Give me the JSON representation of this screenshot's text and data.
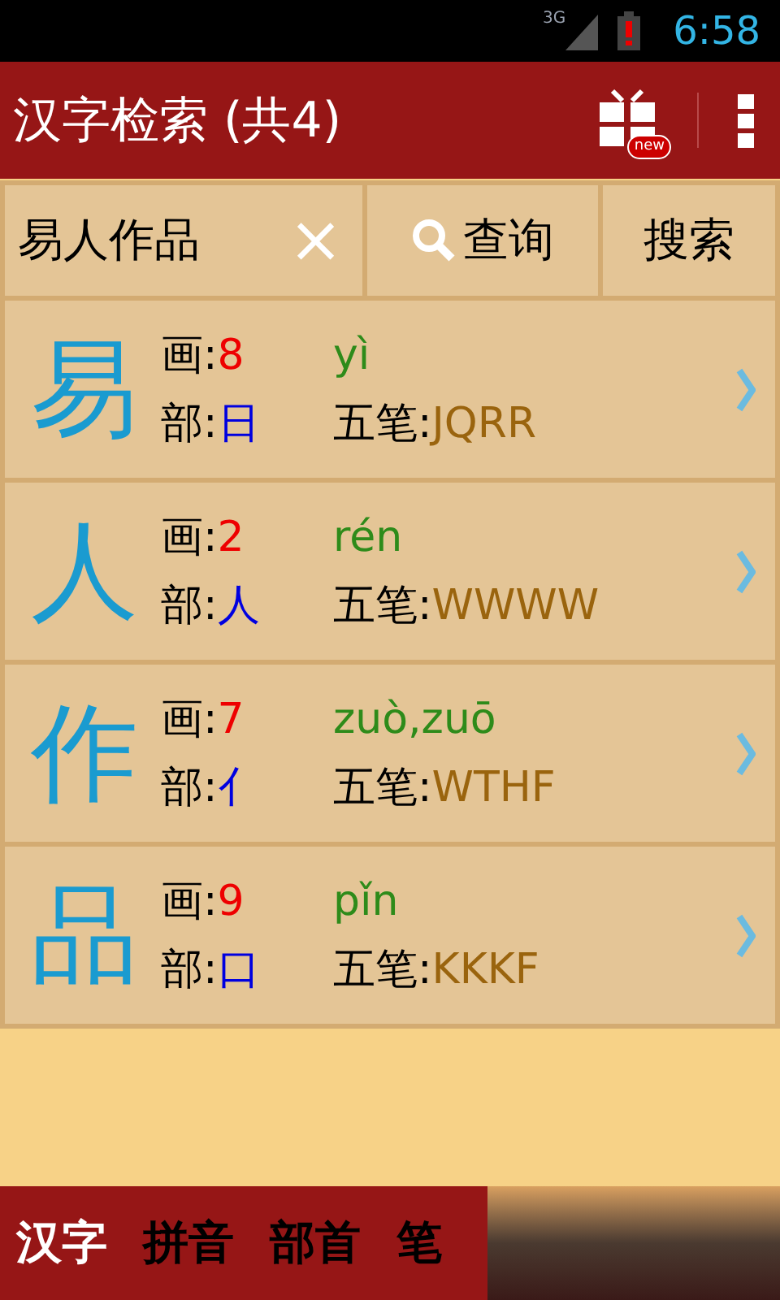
{
  "status_bar": {
    "network": "3G",
    "time": "6:58"
  },
  "app_bar": {
    "title": "汉字检索 (共4)",
    "badge": "new"
  },
  "search": {
    "value": "易人作品",
    "clear": "×",
    "query_button": "查询",
    "search_button": "搜索"
  },
  "results": [
    {
      "char": "易",
      "strokes_label": "画:",
      "strokes": "8",
      "radical_label": "部:",
      "radical": "日",
      "pinyin": "yì",
      "wubi_label": "五笔:",
      "wubi": "JQRR"
    },
    {
      "char": "人",
      "strokes_label": "画:",
      "strokes": "2",
      "radical_label": "部:",
      "radical": "人",
      "pinyin": "rén",
      "wubi_label": "五笔:",
      "wubi": "WWWW"
    },
    {
      "char": "作",
      "strokes_label": "画:",
      "strokes": "7",
      "radical_label": "部:",
      "radical": "亻",
      "pinyin": "zuò,zuō",
      "wubi_label": "五笔:",
      "wubi": "WTHF"
    },
    {
      "char": "品",
      "strokes_label": "画:",
      "strokes": "9",
      "radical_label": "部:",
      "radical": "口",
      "pinyin": "pǐn",
      "wubi_label": "五笔:",
      "wubi": "KKKF"
    }
  ],
  "tabs": [
    {
      "label": "汉字",
      "selected": true
    },
    {
      "label": "拼音",
      "selected": false
    },
    {
      "label": "部首",
      "selected": false
    },
    {
      "label": "笔",
      "selected": false
    }
  ]
}
